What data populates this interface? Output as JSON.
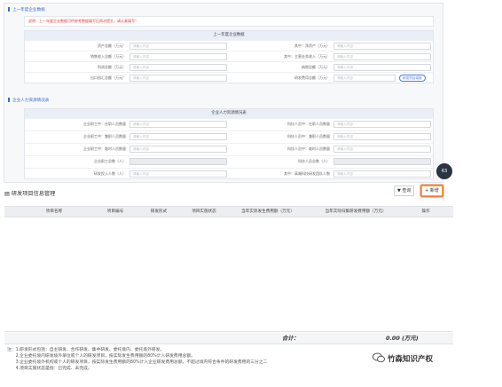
{
  "form": {
    "sec1_title": "上一年度企业数据",
    "notice": "说明：上一年度企业数据可供参考数据填写后再次提交，请认真填写！",
    "card1_title": "上一年度企业数据",
    "card1_rows": [
      {
        "l_label": "资产总额（万元）",
        "l_ph": "请输入内容",
        "r_label": "其中：净资产（万元）",
        "r_ph": "请输入内容"
      },
      {
        "l_label": "销售收入总额（万元）",
        "l_ph": "请输入内容",
        "r_label": "其中：主营业务收入（万元）",
        "r_ph": "请输入内容"
      },
      {
        "l_label": "利润总额（万元）",
        "l_ph": "请输入内容",
        "r_label": "纳税总额（万元）",
        "r_ph": "请输入内容"
      },
      {
        "l_label": "出口创汇总额（万元）",
        "l_ph": "请输入内容",
        "r_label": "研发费用总额（万元）",
        "r_ph": "请输入内容",
        "btn": "研发项目填报"
      }
    ],
    "sec2_title": "企业人力资源情况表",
    "card2_title": "企业人力资源情况表",
    "card2_rows": [
      {
        "l_label": "企业职工中：在职人员数量",
        "l_ph": "请输入内容",
        "r_label": "科技人员中：在职人员数量",
        "r_ph": "请输入内容"
      },
      {
        "l_label": "企业职工中：兼职人员数量",
        "l_ph": "请输入内容",
        "r_label": "科技人员中：兼职人员数量",
        "r_ph": "请输入内容"
      },
      {
        "l_label": "企业职工中：临时人员数量",
        "l_ph": "请输入内容",
        "r_label": "科技人员中：临时人员数量",
        "r_ph": "请输入内容"
      },
      {
        "l_label": "企业职工总数（人）",
        "l_ph": "",
        "r_label": "科技人员总数（人）",
        "r_ph": "",
        "disabled": true
      },
      {
        "l_label": "研发投入人数（人）",
        "l_ph": "请输入内容",
        "r_label": "其中：高端科技研发团队人数",
        "r_ph": "请输入内容"
      }
    ]
  },
  "float_badge": "63",
  "mgmt": {
    "icon": "▤",
    "title": "研发项目信息管理",
    "query_btn": "▼ 查询",
    "add_btn": "+ 新增"
  },
  "table": {
    "columns": [
      "项目名称",
      "项目编号",
      "研发形式",
      "项目实施状态",
      "当年实际发生费用额（万元）",
      "当年实际归集研发费用额（万元）",
      "操作"
    ],
    "sum_label": "合计：",
    "sum_value": "0.00 (万元)"
  },
  "notes": [
    "注：1.研发形式包括：自主研发、合作研发、集中研发、委托境内、委托境外研发。",
    "　　2.企业委托境内研发境外单位或个人的研发项目，按实际发生费用额的80%计入研发费用总额。",
    "　　3.企业委托境外机构或个人的研发项目，按实际发生费用额的80%计入企业研发费用总额，不超过境内符合条件的研发费用的三分之二",
    "　　4.项目实施状态是指：已完成、未完成。"
  ],
  "watermark": "竹森知识产权"
}
